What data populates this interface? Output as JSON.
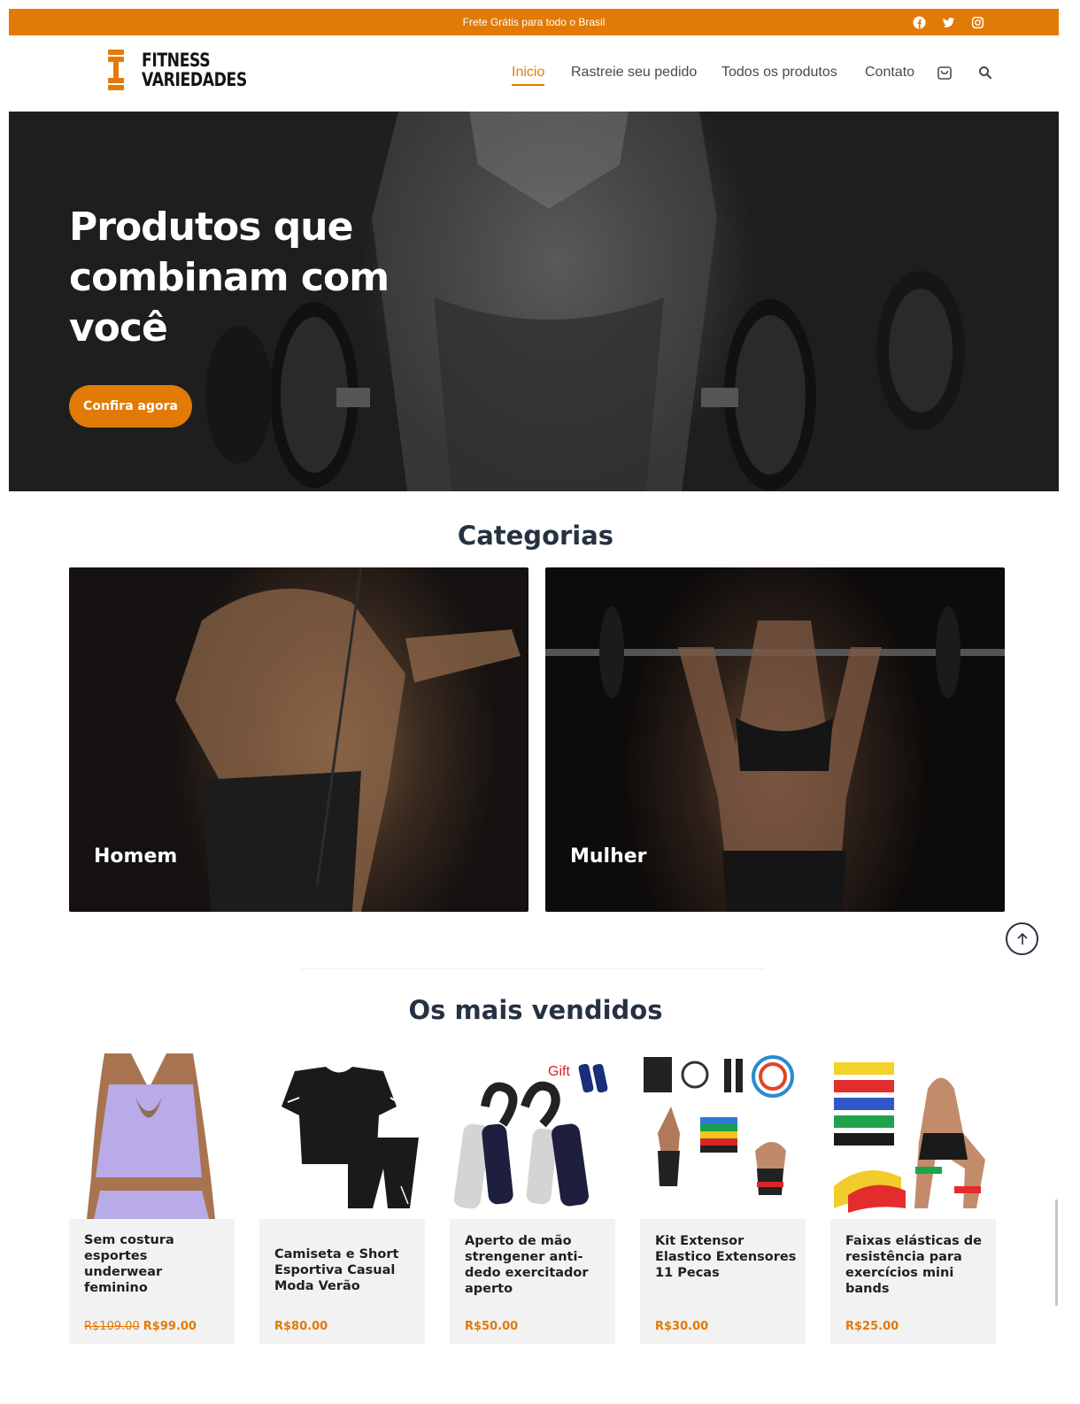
{
  "topbar": {
    "text": "Frete Grátis para todo o Brasil",
    "icons": [
      "facebook-icon",
      "twitter-icon",
      "instagram-icon"
    ]
  },
  "header": {
    "logo_line1": "FITNESS",
    "logo_line2": "VARIEDADES",
    "nav": [
      "Inicio",
      "Rastreie seu pedido",
      "Todos os produtos",
      "Contato"
    ],
    "active_index": 0,
    "icons": [
      "cart-icon",
      "search-icon"
    ]
  },
  "hero": {
    "title": "Produtos que combinam com você",
    "button": "Confira agora"
  },
  "categories": {
    "title": "Categorias",
    "items": [
      {
        "label": "Homem"
      },
      {
        "label": "Mulher"
      }
    ]
  },
  "bestsellers": {
    "title": "Os mais vendidos",
    "products": [
      {
        "name": "Sem costura esportes underwear feminino",
        "old_price": "R$109.00",
        "price": "R$99.00"
      },
      {
        "name": "Camiseta e Short Esportiva Casual Moda Verão",
        "old_price": "",
        "price": "R$80.00"
      },
      {
        "name": "Aperto de mão strengener anti-dedo exercitador aperto",
        "old_price": "",
        "price": "R$50.00",
        "image_text": "Gift"
      },
      {
        "name": "Kit Extensor Elastico Extensores 11 Pecas",
        "old_price": "",
        "price": "R$30.00"
      },
      {
        "name": "Faixas elásticas de resistência para exercícios mini bands",
        "old_price": "",
        "price": "R$25.00"
      }
    ]
  },
  "colors": {
    "accent": "#e27a06",
    "heading": "#263242"
  }
}
